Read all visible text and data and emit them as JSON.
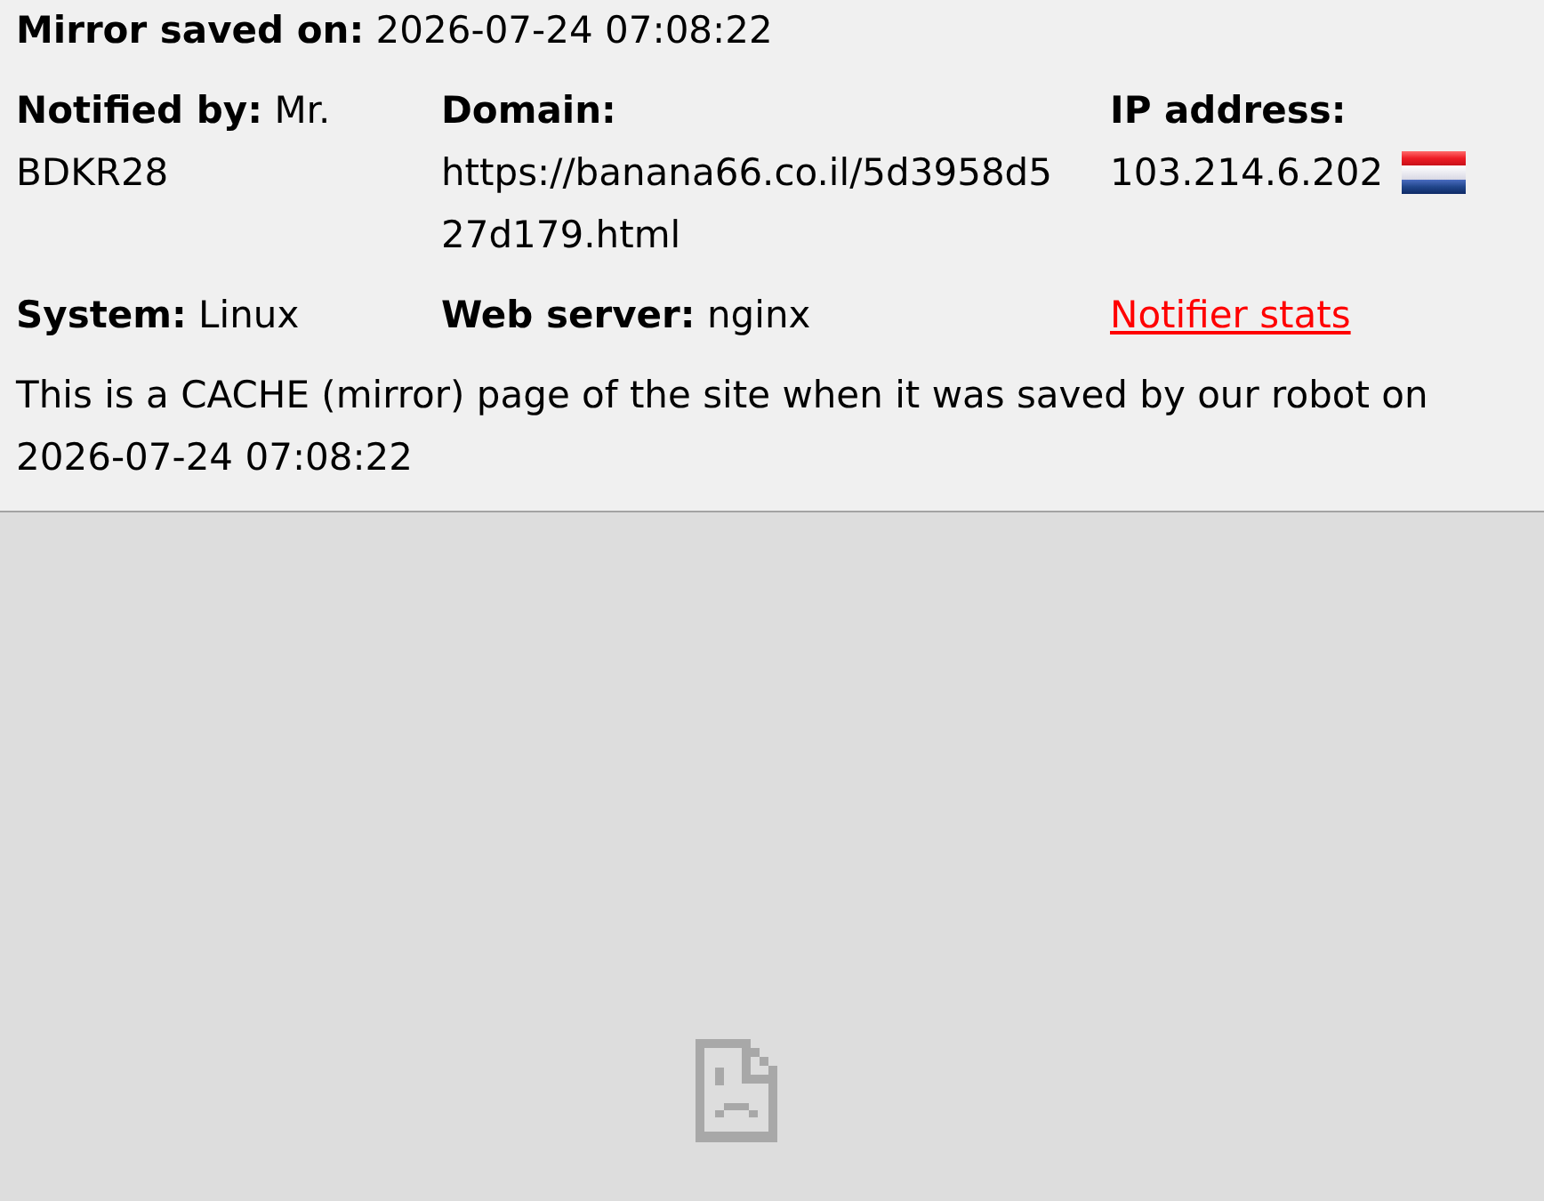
{
  "header": {
    "saved": "**Mirror saved on:** 2026-07-24 07:08:22"
  },
  "details": [
    {
      "kind": "text",
      "text": "**Notified by:** Mr. BDKR28"
    },
    {
      "kind": "text",
      "text": "**Domain:** https://banana66.co.il/5d3958d527d179.html"
    },
    {
      "kind": "ip",
      "text": "**IP address:** 103.214.6.202"
    },
    {
      "kind": "text",
      "text": "**System:** Linux"
    },
    {
      "kind": "text",
      "text": "**Web server:** nginx"
    },
    {
      "kind": "link",
      "text": "Notifier stats"
    }
  ],
  "note": "This is a CACHE (mirror) page of the site when it was saved by our robot on 2026-07-24 07:08:22"
}
